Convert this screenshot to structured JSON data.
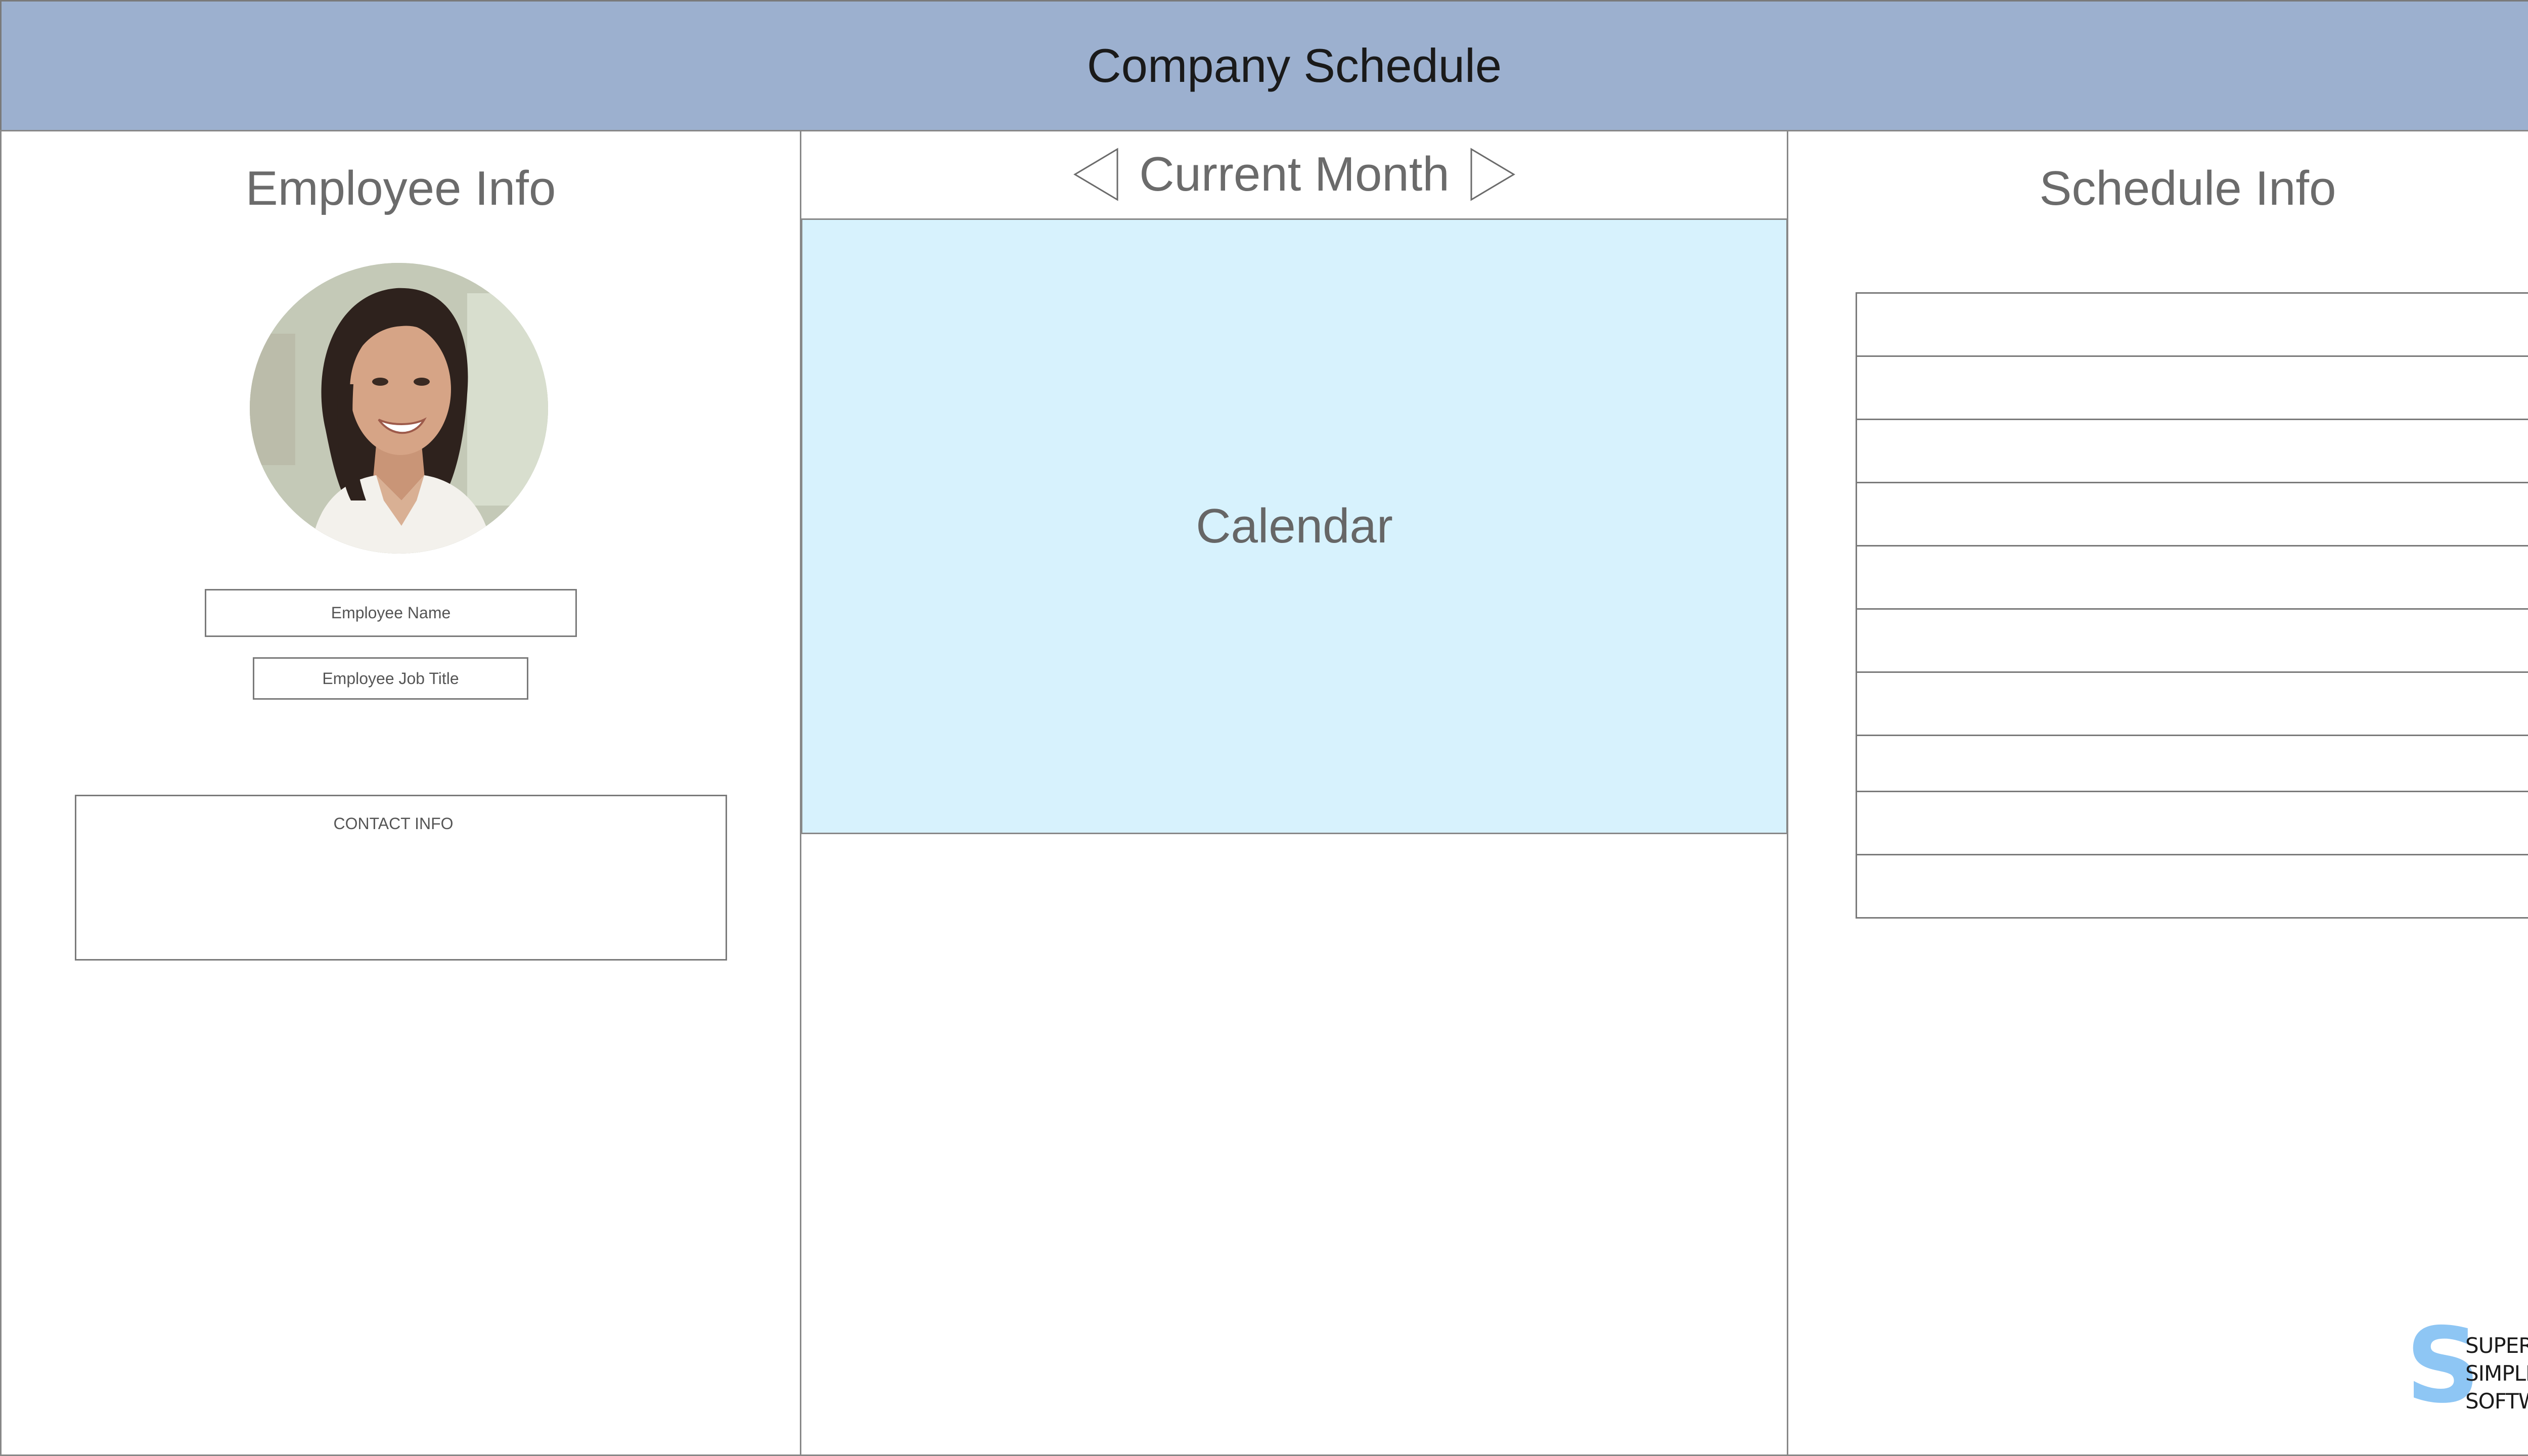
{
  "header": {
    "title": "Company Schedule"
  },
  "employee_panel": {
    "heading": "Employee Info",
    "name_placeholder": "Employee Name",
    "job_title_placeholder": "Employee Job Title",
    "contact_label": "CONTACT INFO"
  },
  "calendar_panel": {
    "month_label": "Current Month",
    "prev_icon": "triangle-left-icon",
    "next_icon": "triangle-right-icon",
    "calendar_label": "Calendar",
    "calendar_color": "#d7f2fd"
  },
  "schedule_panel": {
    "heading": "Schedule Info",
    "row_count": 10
  },
  "logo": {
    "letter": "S",
    "line1": "SUPER",
    "line2": "SIMPLE",
    "line3": "SOFTWARE",
    "color": "#8ec6f4"
  },
  "colors": {
    "header_bg": "#9cb0cf",
    "border": "#7a7a7a"
  }
}
